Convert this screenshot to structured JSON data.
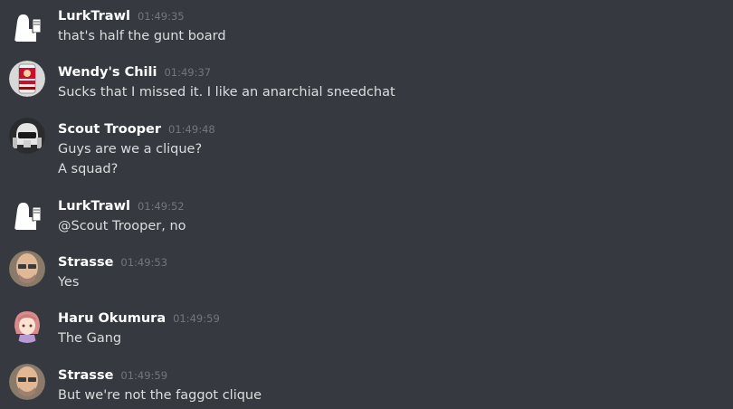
{
  "messages": [
    {
      "author": "LurkTrawl",
      "time": "01:49:35",
      "avatar_icon": "lurkers-sign-icon",
      "lines": [
        "that's half the gunt board"
      ]
    },
    {
      "author": "Wendy's Chili",
      "time": "01:49:37",
      "avatar_icon": "chili-can-icon",
      "lines": [
        "Sucks that I missed it. I like an anarchial sneedchat"
      ]
    },
    {
      "author": "Scout Trooper",
      "time": "01:49:48",
      "avatar_icon": "scout-trooper-helmet-icon",
      "lines": [
        "Guys are we a clique?",
        "A squad?"
      ]
    },
    {
      "author": "LurkTrawl",
      "time": "01:49:52",
      "avatar_icon": "lurkers-sign-icon",
      "lines": [
        "@Scout Trooper, no"
      ]
    },
    {
      "author": "Strasse",
      "time": "01:49:53",
      "avatar_icon": "bald-man-face-icon",
      "lines": [
        "Yes"
      ]
    },
    {
      "author": "Haru Okumura",
      "time": "01:49:59",
      "avatar_icon": "anime-girl-icon",
      "lines": [
        "The Gang"
      ]
    },
    {
      "author": "Strasse",
      "time": "01:49:59",
      "avatar_icon": "bald-man-face-icon",
      "lines": [
        "But we're not the faggot clique"
      ]
    }
  ]
}
